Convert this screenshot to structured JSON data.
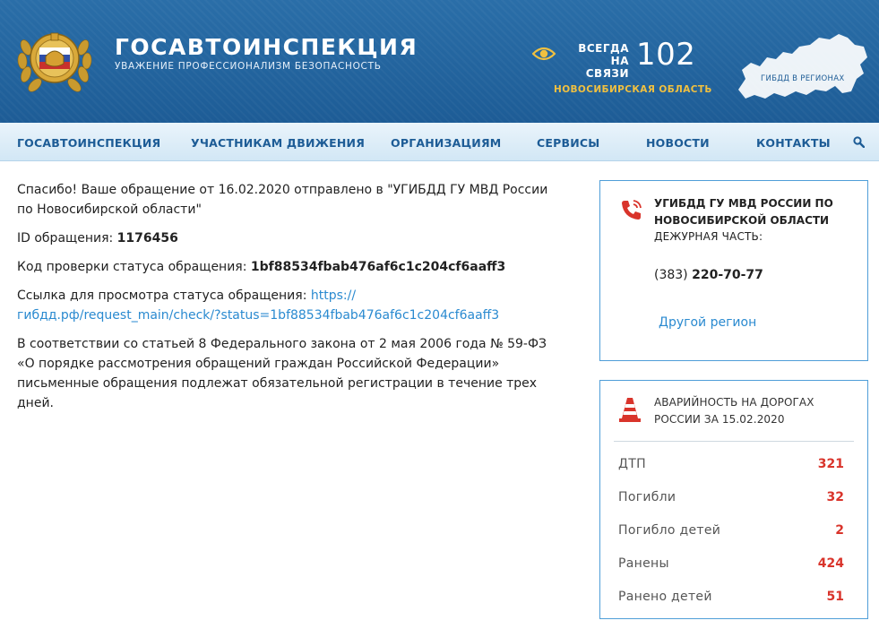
{
  "header": {
    "brand_title": "ГОСАВТОИНСПЕКЦИЯ",
    "brand_subtitle": "УВАЖЕНИЕ ПРОФЕССИОНАЛИЗМ БЕЗОПАСНОСТЬ",
    "always_line1": "ВСЕГДА",
    "always_line2": "НА СВЯЗИ",
    "phone": "102",
    "region": "НОВОСИБИРСКАЯ ОБЛАСТЬ",
    "map_label": "ГИБДД В РЕГИОНАХ"
  },
  "nav": {
    "items": [
      "ГОСАВТОИНСПЕКЦИЯ",
      "УЧАСТНИКАМ ДВИЖЕНИЯ",
      "ОРГАНИЗАЦИЯМ",
      "СЕРВИСЫ",
      "НОВОСТИ",
      "КОНТАКТЫ"
    ]
  },
  "main": {
    "thanks": "Спасибо! Ваше обращение от 16.02.2020 отправлено в \"УГИБДД ГУ МВД России по Новосибирской области\"",
    "id_label": "ID обращения: ",
    "id_value": "1176456",
    "code_label": "Код проверки статуса обращения: ",
    "code_value": "1bf88534fbab476af6c1c204cf6aaff3",
    "link_label": "Ссылка для просмотра статуса обращения: ",
    "link_value": "https://гибдд.рф/request_main/check/?status=1bf88534fbab476af6c1c204cf6aaff3",
    "law_text": "В соответствии со статьей 8 Федерального закона от 2 мая 2006 года № 59-ФЗ «О порядке рассмотрения обращений граждан Российской Федерации» письменные обращения подлежат обязательной регистрации в течение трех дней."
  },
  "contact_box": {
    "title": "УГИБДД ГУ МВД РОССИИ ПО НОВОСИБИРСКОЙ ОБЛАСТИ",
    "subtitle": "ДЕЖУРНАЯ ЧАСТЬ:",
    "phone_code": "(383) ",
    "phone_number": "220-70-77",
    "other_region": "Другой регион"
  },
  "accidents_box": {
    "title": "АВАРИЙНОСТЬ НА ДОРОГАХ РОССИИ ЗА 15.02.2020",
    "rows": [
      {
        "label": "ДТП",
        "value": "321"
      },
      {
        "label": "Погибли",
        "value": "32"
      },
      {
        "label": "Погибло детей",
        "value": "2"
      },
      {
        "label": "Ранены",
        "value": "424"
      },
      {
        "label": "Ранено детей",
        "value": "51"
      }
    ]
  },
  "colors": {
    "header_blue": "#1d5c96",
    "accent_yellow": "#f0c040",
    "link_blue": "#2a8ad0",
    "stat_red": "#d9342b",
    "box_border": "#4f9ed8"
  },
  "icons": [
    "emblem-icon",
    "eye-icon",
    "russia-map-icon",
    "search-icon",
    "phone-icon",
    "traffic-cone-icon"
  ]
}
